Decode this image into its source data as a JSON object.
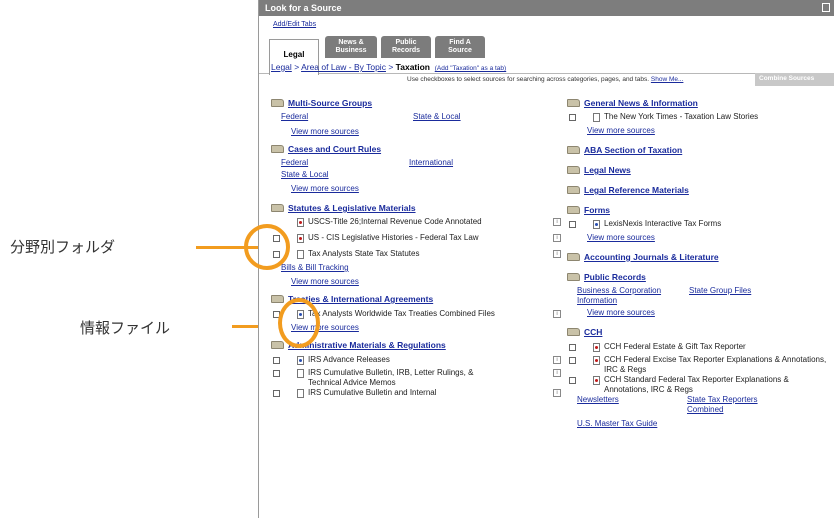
{
  "annotations": {
    "folder_label": "分野別フォルダ",
    "file_label": "情報ファイル",
    "accent_color": "#f29c1f"
  },
  "window": {
    "title": "Look for a Source",
    "add_edit_tabs": "Add/Edit Tabs"
  },
  "tabs": [
    {
      "line1": "Legal",
      "line2": ""
    },
    {
      "line1": "News &",
      "line2": "Business"
    },
    {
      "line1": "Public",
      "line2": "Records"
    },
    {
      "line1": "Find A",
      "line2": "Source"
    }
  ],
  "breadcrumb": {
    "legal": "Legal",
    "sep": ">",
    "area": "Area of Law - By Topic",
    "current": "Taxation",
    "add_tab": "(Add \"Taxation\" as a tab)"
  },
  "instructions": {
    "text": "Use checkboxes to select sources for searching across categories, pages, and tabs.",
    "show_me": "Show Me...",
    "combine_button": "Combine Sources"
  },
  "left_column": {
    "multi_source": {
      "title": "Multi-Source Groups",
      "link1": "Federal",
      "link2": "State & Local",
      "more": "View more sources"
    },
    "cases": {
      "title": "Cases and Court Rules",
      "link1": "Federal",
      "link2": "International",
      "link3": "State & Local",
      "more": "View more sources"
    },
    "statutes": {
      "title": "Statutes & Legislative Materials",
      "items": [
        "USCS-Title 26;Internal Revenue Code Annotated",
        "US - CIS Legislative Histories - Federal Tax Law",
        "Tax Analysts State Tax Statutes"
      ],
      "bill_tracking": "Bills & Bill Tracking",
      "more": "View more sources"
    },
    "treaties": {
      "title": "Treaties & International Agreements",
      "items": [
        "Tax Analysts Worldwide Tax Treaties Combined Files"
      ],
      "more": "View more sources"
    },
    "admin": {
      "title": "Administrative Materials & Regulations",
      "items": [
        "IRS Advance Releases",
        "IRS Cumulative Bulletin, IRB, Letter Rulings, & Technical Advice Memos",
        "IRS Cumulative Bulletin and Internal"
      ]
    }
  },
  "right_column": {
    "news": {
      "title": "General News & Information",
      "items": [
        "The New York Times - Taxation Law Stories"
      ],
      "more": "View more sources"
    },
    "aba": {
      "title": "ABA Section of Taxation"
    },
    "legal_news": {
      "title": "Legal News"
    },
    "legal_ref": {
      "title": "Legal Reference Materials"
    },
    "forms": {
      "title": "Forms",
      "items": [
        "LexisNexis Interactive Tax Forms"
      ],
      "more": "View more sources"
    },
    "accounting": {
      "title": "Accounting Journals & Literature"
    },
    "public_records": {
      "title": "Public Records",
      "link1": "Business & Corporation Information",
      "link2": "State Group Files",
      "more": "View more sources"
    },
    "cch": {
      "title": "CCH",
      "items": [
        "CCH Federal Estate & Gift Tax Reporter",
        "CCH Federal Excise Tax Reporter Explanations & Annotations, IRC & Regs",
        "CCH Standard Federal Tax Reporter Explanations & Annotations, IRC & Regs"
      ],
      "newsletters": "Newsletters",
      "state_reporters": "State Tax Reporters Combined",
      "master_guide": "U.S. Master Tax Guide"
    }
  }
}
